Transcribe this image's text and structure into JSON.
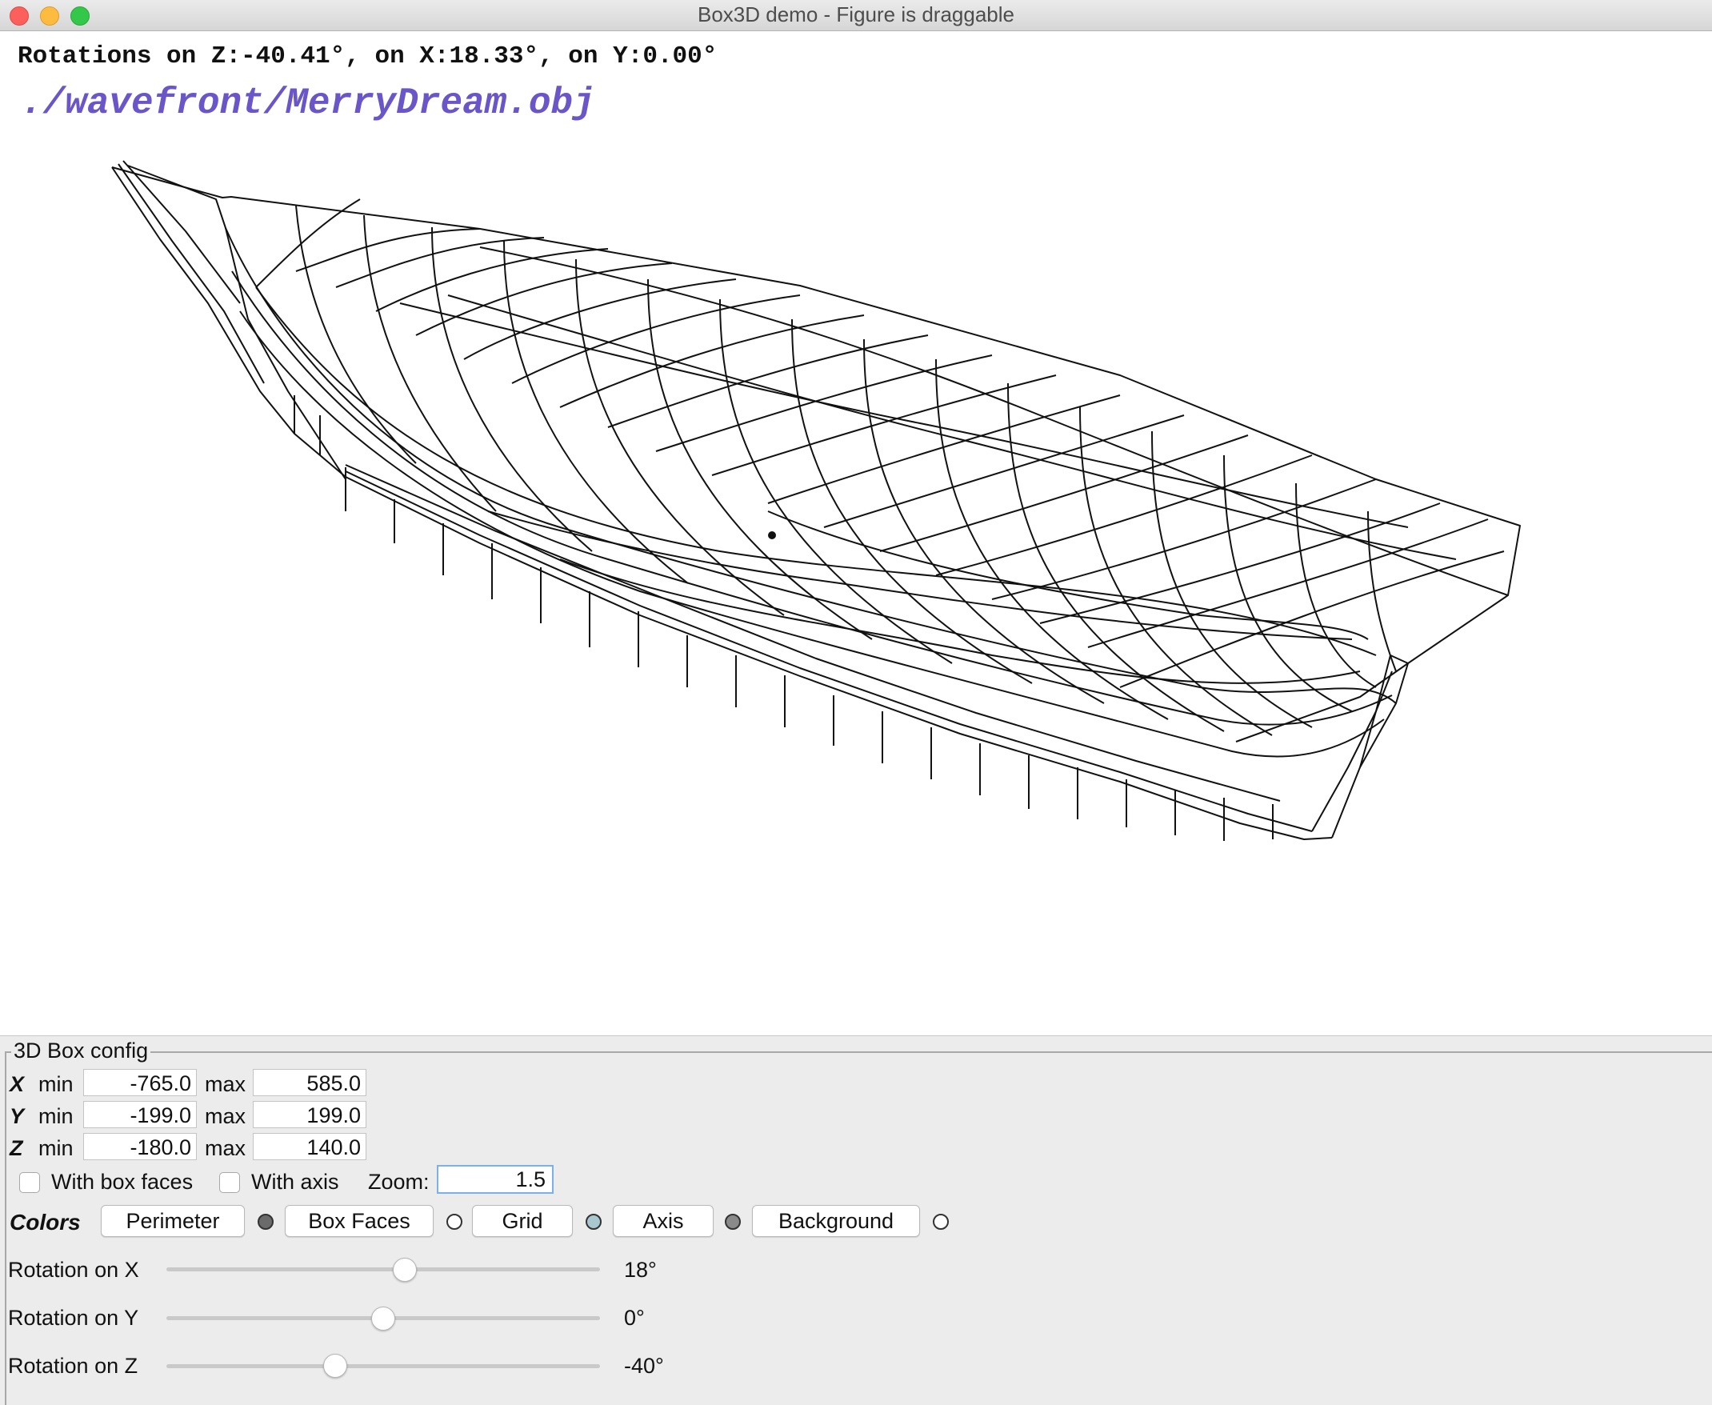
{
  "window": {
    "title": "Box3D demo - Figure is draggable"
  },
  "canvas": {
    "rotation_readout": "Rotations on Z:-40.41°, on X:18.33°, on Y:0.00°",
    "file_path": "./wavefront/MerryDream.obj"
  },
  "config": {
    "group_title": "3D Box config",
    "min_label": "min",
    "max_label": "max",
    "axes": [
      {
        "name": "X",
        "min": "-765.0",
        "max": "585.0"
      },
      {
        "name": "Y",
        "min": "-199.0",
        "max": "199.0"
      },
      {
        "name": "Z",
        "min": "-180.0",
        "max": "140.0"
      }
    ],
    "with_box_faces_label": "With box faces",
    "with_box_faces_checked": false,
    "with_axis_label": "With axis",
    "with_axis_checked": false,
    "zoom_label": "Zoom:",
    "zoom_value": "1.5"
  },
  "colors": {
    "label": "Colors",
    "buttons": [
      {
        "label": "Perimeter",
        "swatch": "#6b6b6b"
      },
      {
        "label": "Box Faces",
        "swatch": "#ffffff"
      },
      {
        "label": "Grid",
        "swatch": "#a9c7cf"
      },
      {
        "label": "Axis",
        "swatch": "#8a8a8a"
      },
      {
        "label": "Background",
        "swatch": "#ffffff"
      }
    ]
  },
  "sliders": [
    {
      "label": "Rotation on X",
      "value_text": "18°",
      "value": 18,
      "min": -180,
      "max": 180
    },
    {
      "label": "Rotation on Y",
      "value_text": "0°",
      "value": 0,
      "min": -180,
      "max": 180
    },
    {
      "label": "Rotation on Z",
      "value_text": "-40°",
      "value": -40,
      "min": -180,
      "max": 180
    }
  ]
}
